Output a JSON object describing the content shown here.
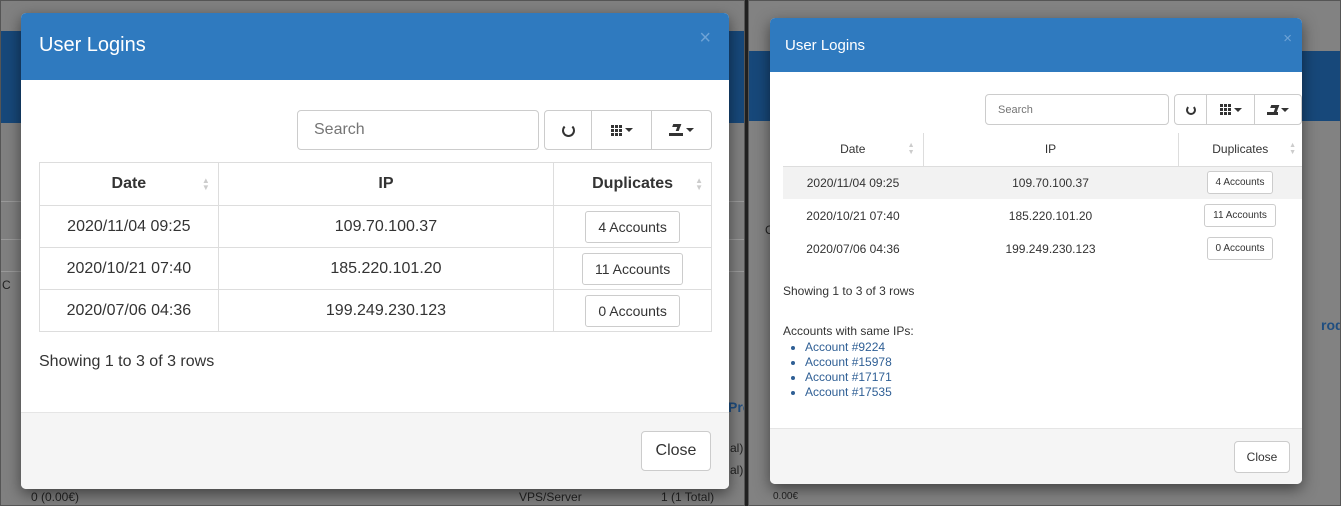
{
  "left": {
    "modal": {
      "title": "User Logins",
      "close_x": "×",
      "search_placeholder": "Search",
      "columns": [
        "Date",
        "IP",
        "Duplicates"
      ],
      "rows": [
        {
          "date": "2020/11/04 09:25",
          "ip": "109.70.100.37",
          "duplicates": "4 Accounts"
        },
        {
          "date": "2020/10/21 07:40",
          "ip": "185.220.101.20",
          "duplicates": "11 Accounts"
        },
        {
          "date": "2020/07/06 04:36",
          "ip": "199.249.230.123",
          "duplicates": "0 Accounts"
        }
      ],
      "pagination_info": "Showing 1 to 3 of 3 rows",
      "close_label": "Close"
    },
    "background": {
      "bottom_left": "0 (0.00€)",
      "bottom_mid": "VPS/Server",
      "bottom_right": "1 (1 Total)",
      "side_a": "al)",
      "side_b": "al)",
      "side_c": "Pro",
      "side_d": "C"
    }
  },
  "right": {
    "modal": {
      "title": "User Logins",
      "close_x": "×",
      "search_placeholder": "Search",
      "columns": [
        "Date",
        "IP",
        "Duplicates"
      ],
      "rows": [
        {
          "date": "2020/11/04 09:25",
          "ip": "109.70.100.37",
          "duplicates": "4 Accounts"
        },
        {
          "date": "2020/10/21 07:40",
          "ip": "185.220.101.20",
          "duplicates": "11 Accounts"
        },
        {
          "date": "2020/07/06 04:36",
          "ip": "199.249.230.123",
          "duplicates": "0 Accounts"
        }
      ],
      "pagination_info": "Showing 1 to 3 of 3 rows",
      "same_ip_heading": "Accounts with same IPs:",
      "accounts": [
        "Account #9224",
        "Account #15978",
        "Account #17171",
        "Account #17535"
      ],
      "close_label": "Close"
    },
    "background": {
      "bottom_left": "0.00€",
      "side_a": "rod",
      "side_c": "C"
    }
  },
  "colors": {
    "header_blue": "#2f7abf",
    "backdrop": "#808080",
    "row_highlight": "#f2f2f2"
  }
}
